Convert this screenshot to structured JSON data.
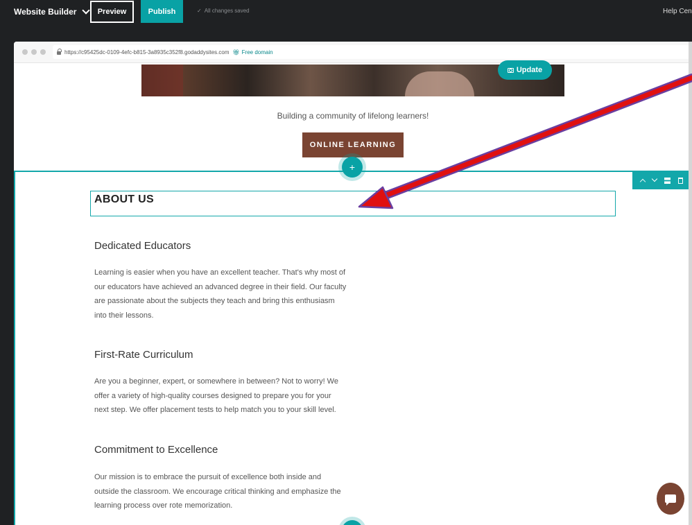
{
  "topbar": {
    "brand": "Website Builder",
    "preview_label": "Preview",
    "publish_label": "Publish",
    "saved_status": "All changes saved",
    "help_label": "Help Center"
  },
  "browser": {
    "url": "https://c95425dc-0109-4efc-b815-3a8935c352f8.godaddysites.com",
    "free_domain": "Free domain"
  },
  "hero": {
    "update_label": "Update",
    "tagline": "Building a community of lifelong learners!",
    "cta_label": "ONLINE LEARNING"
  },
  "about": {
    "title": "ABOUT US",
    "items": [
      {
        "heading": "Dedicated Educators",
        "body": "Learning is easier when you have an excellent teacher. That's why most of our educators have achieved an advanced degree in their field. Our faculty are passionate about the subjects they teach and bring this enthusiasm into their lessons."
      },
      {
        "heading": "First-Rate Curriculum",
        "body": "Are you a beginner, expert, or somewhere in between? Not to worry! We offer a variety of high-quality courses designed to prepare you for your next step. We offer placement tests to help match you to your skill level."
      },
      {
        "heading": "Commitment to Excellence",
        "body": "Our mission is to embrace the pursuit of excellence both inside and outside the classroom. We encourage critical thinking and emphasize the learning process over rote memorization."
      }
    ]
  },
  "section_add_symbol": "+",
  "colors": {
    "accent": "#09a2a5",
    "brand_brown": "#7a4432",
    "arrow": "#e01010"
  }
}
